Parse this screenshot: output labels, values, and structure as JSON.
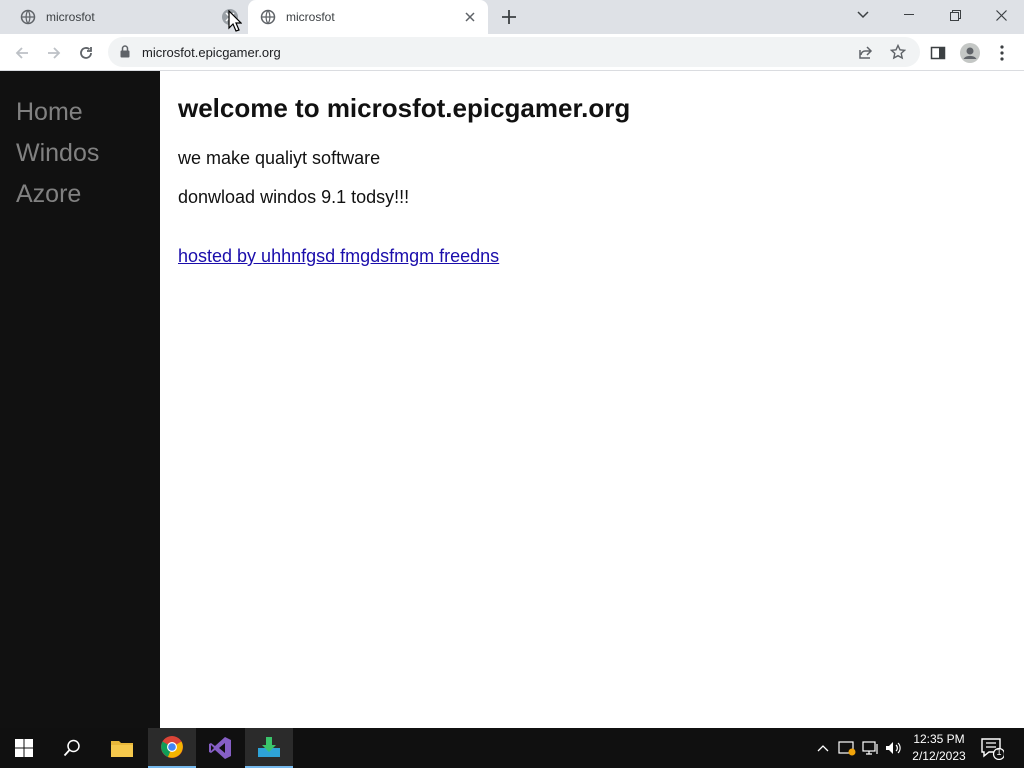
{
  "browser": {
    "tabs": [
      {
        "title": "microsfot"
      },
      {
        "title": "microsfot"
      }
    ],
    "url": "microsfot.epicgamer.org"
  },
  "page": {
    "nav": [
      "Home",
      "Windos",
      "Azore"
    ],
    "heading": "welcome to microsfot.epicgamer.org",
    "paragraph1": "we make qualiyt software",
    "paragraph2": "donwload windos 9.1 todsy!!!",
    "link": "hosted by uhhnfgsd fmgdsfmgm freedns"
  },
  "taskbar": {
    "time": "12:35 PM",
    "date": "2/12/2023",
    "notification_count": "1"
  }
}
